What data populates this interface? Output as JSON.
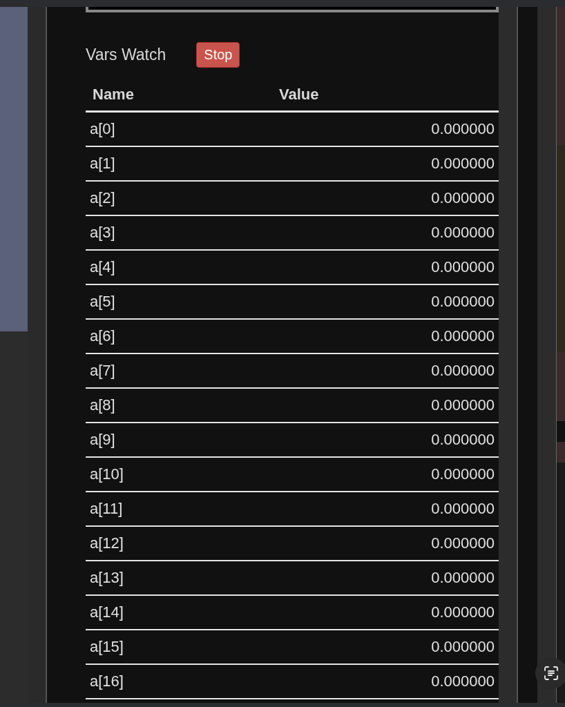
{
  "panel": {
    "title": "Vars Watch",
    "stop_button": "Stop"
  },
  "table": {
    "columns": [
      "Name",
      "Value"
    ],
    "rows": [
      {
        "name": "a[0]",
        "value": "0.000000"
      },
      {
        "name": "a[1]",
        "value": "0.000000"
      },
      {
        "name": "a[2]",
        "value": "0.000000"
      },
      {
        "name": "a[3]",
        "value": "0.000000"
      },
      {
        "name": "a[4]",
        "value": "0.000000"
      },
      {
        "name": "a[5]",
        "value": "0.000000"
      },
      {
        "name": "a[6]",
        "value": "0.000000"
      },
      {
        "name": "a[7]",
        "value": "0.000000"
      },
      {
        "name": "a[8]",
        "value": "0.000000"
      },
      {
        "name": "a[9]",
        "value": "0.000000"
      },
      {
        "name": "a[10]",
        "value": "0.000000"
      },
      {
        "name": "a[11]",
        "value": "0.000000"
      },
      {
        "name": "a[12]",
        "value": "0.000000"
      },
      {
        "name": "a[13]",
        "value": "0.000000"
      },
      {
        "name": "a[14]",
        "value": "0.000000"
      },
      {
        "name": "a[15]",
        "value": "0.000000"
      },
      {
        "name": "a[16]",
        "value": "0.000000"
      }
    ]
  }
}
